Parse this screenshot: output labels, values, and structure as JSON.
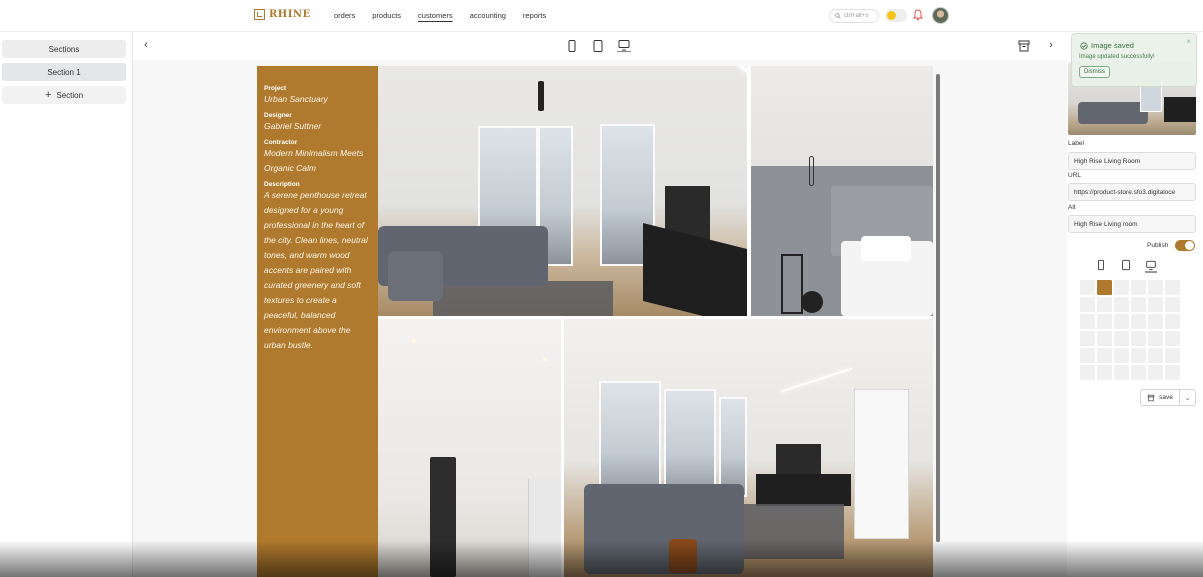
{
  "brand": {
    "name": "RHINE",
    "color": "#b07a2e"
  },
  "nav": {
    "items": [
      "orders",
      "products",
      "customers",
      "accounting",
      "reports"
    ],
    "active": "customers"
  },
  "search": {
    "shortcut": "ctrl+alt+s"
  },
  "sidebar": {
    "sections_label": "Sections",
    "section1_label": "Section 1",
    "add_section_label": "Section"
  },
  "project": {
    "project_label": "Project",
    "project_value": "Urban Sanctuary",
    "designer_label": "Designer",
    "designer_value": "Gabriel Suttner",
    "contractor_label": "Contractor",
    "contractor_value": "Modern Minimalism Meets Organic Calm",
    "description_label": "Description",
    "description_value": "A serene penthouse retreat designed for a young professional in the heart of the city. Clean lines, neutral tones, and warm wood accents are paired with curated greenery and soft textures to create a peaceful, balanced environment above the urban bustle."
  },
  "toast": {
    "title": "Image saved",
    "message": "Image updated successfully!",
    "dismiss_label": "Dismiss"
  },
  "editor": {
    "label_title": "Label",
    "label_value": "High Rise Living Room",
    "url_title": "URL",
    "url_value": "https://product-store.sfo3.digitaloce",
    "alt_title": "Alt",
    "alt_value": "High Rise Living room",
    "publish_label": "Publish",
    "publish_on": true,
    "save_label": "save",
    "grid_rows": 6,
    "grid_cols": 6,
    "grid_filled": [
      [
        0,
        1
      ]
    ]
  },
  "colors": {
    "accent": "#b07a2e",
    "toast_bg": "#e9f2e8",
    "toast_text": "#2f6b34"
  }
}
